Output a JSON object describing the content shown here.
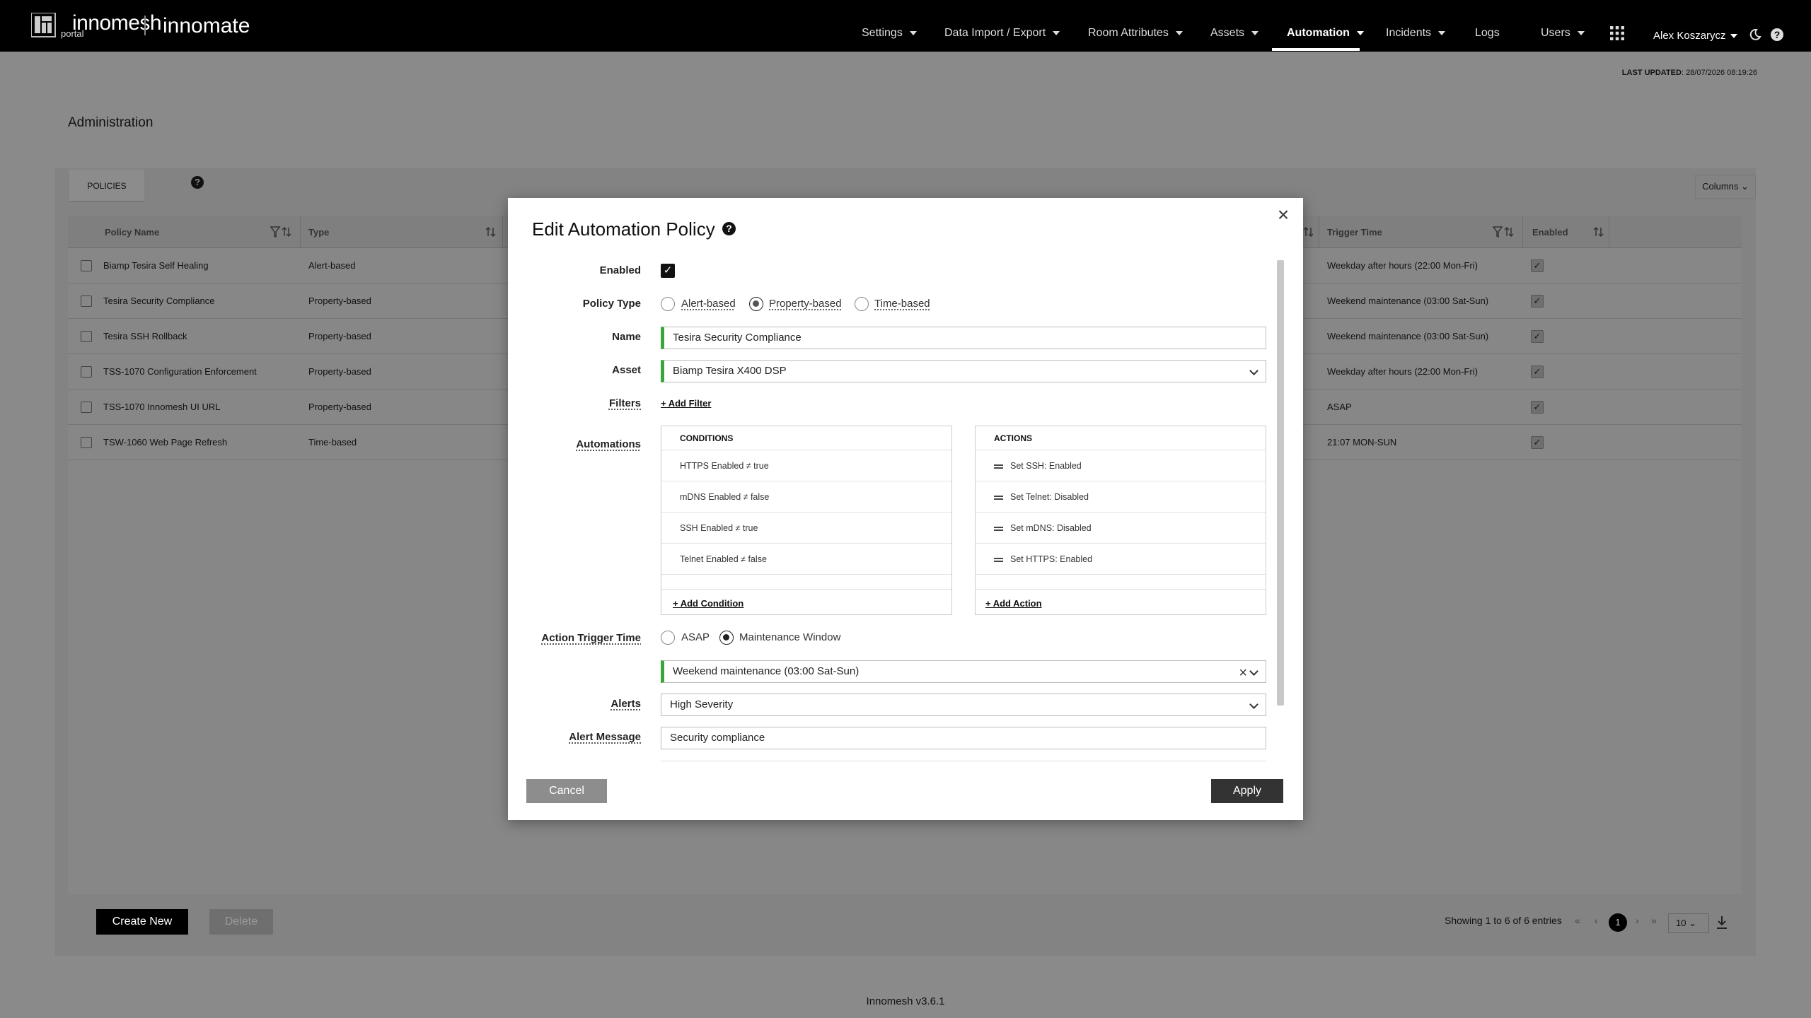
{
  "header": {
    "brand": "innomesh",
    "brand_sub": "portal",
    "brand2": "innomate",
    "nav": [
      {
        "label": "Settings",
        "caret": true
      },
      {
        "label": "Data Import / Export",
        "caret": true
      },
      {
        "label": "Room Attributes",
        "caret": true
      },
      {
        "label": "Assets",
        "caret": true
      },
      {
        "label": "Automation",
        "caret": true,
        "active": true
      },
      {
        "label": "Incidents",
        "caret": true
      },
      {
        "label": "Logs",
        "caret": false
      },
      {
        "label": "Users",
        "caret": true
      }
    ],
    "user": "Alex Koszarycz",
    "icons": [
      "apps-grid-icon",
      "moon-icon",
      "help-icon"
    ]
  },
  "last_updated": {
    "label": "LAST UPDATED",
    "value": "28/07/2026 08:19:26"
  },
  "page_title": "Administration",
  "tabs": {
    "policies": "POLICIES"
  },
  "columns_button": "Columns",
  "table": {
    "headers": {
      "name": "Policy Name",
      "type": "Type",
      "trigger": "Trigger Time",
      "enabled": "Enabled"
    },
    "rows": [
      {
        "name": "Biamp Tesira Self Healing",
        "type": "Alert-based",
        "trigger": "Weekday after hours (22:00 Mon-Fri)",
        "enabled": true
      },
      {
        "name": "Tesira Security Compliance",
        "type": "Property-based",
        "trigger": "Weekend maintenance (03:00 Sat-Sun)",
        "enabled": true
      },
      {
        "name": "Tesira SSH Rollback",
        "type": "Property-based",
        "trigger": "Weekend maintenance (03:00 Sat-Sun)",
        "enabled": true
      },
      {
        "name": "TSS-1070 Configuration Enforcement",
        "type": "Property-based",
        "trigger": "Weekday after hours (22:00 Mon-Fri)",
        "enabled": true
      },
      {
        "name": "TSS-1070 Innomesh UI URL",
        "type": "Property-based",
        "trigger": "ASAP",
        "enabled": true
      },
      {
        "name": "TSW-1060 Web Page Refresh",
        "type": "Time-based",
        "trigger": "21:07 MON-SUN",
        "enabled": true
      }
    ]
  },
  "footer": {
    "create": "Create New",
    "delete": "Delete",
    "entries": "Showing 1 to 6 of 6 entries",
    "page": "1",
    "page_size": "10",
    "version": "Innomesh v3.6.1"
  },
  "modal": {
    "title": "Edit Automation Policy",
    "labels": {
      "enabled": "Enabled",
      "policy_type": "Policy Type",
      "name": "Name",
      "asset": "Asset",
      "filters": "Filters",
      "automations": "Automations",
      "trigger": "Action Trigger Time",
      "alerts": "Alerts",
      "alert_message": "Alert Message"
    },
    "enabled": true,
    "policy_types": [
      "Alert-based",
      "Property-based",
      "Time-based"
    ],
    "policy_type_selected": "Property-based",
    "name_value": "Tesira Security Compliance",
    "asset_value": "Biamp Tesira X400 DSP",
    "add_filter": "+ Add Filter",
    "conditions": {
      "header": "CONDITIONS",
      "items": [
        "HTTPS Enabled ≠ true",
        "mDNS Enabled ≠ false",
        "SSH Enabled ≠ true",
        "Telnet Enabled ≠ false"
      ],
      "add": "+ Add Condition"
    },
    "actions": {
      "header": "ACTIONS",
      "items": [
        "Set SSH: Enabled",
        "Set Telnet: Disabled",
        "Set mDNS: Disabled",
        "Set HTTPS: Enabled"
      ],
      "add": "+ Add Action"
    },
    "trigger_options": [
      "ASAP",
      "Maintenance Window"
    ],
    "trigger_selected": "Maintenance Window",
    "maintenance_window": "Weekend maintenance (03:00 Sat-Sun)",
    "alerts_value": "High Severity",
    "alert_message_value": "Security compliance",
    "cancel": "Cancel",
    "apply": "Apply"
  },
  "colors": {
    "accent_green": "#3aa63a",
    "topbar": "#000000",
    "overlay": "#8a8a8a"
  }
}
